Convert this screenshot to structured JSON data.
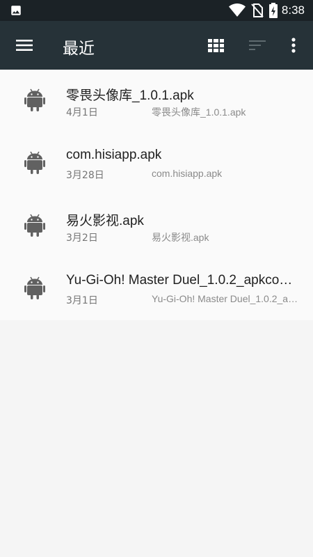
{
  "status_bar": {
    "time": "8:38",
    "icons": [
      "image-icon",
      "wifi-icon",
      "no-sim-icon",
      "battery-charging-icon"
    ]
  },
  "app_bar": {
    "title": "最近",
    "menu_icon": "hamburger-menu-icon",
    "actions": [
      "grid-view-icon",
      "sort-icon",
      "more-vert-icon"
    ]
  },
  "files": [
    {
      "name": "零畏头像库_1.0.1.apk",
      "date": "4月1日",
      "path": "零畏头像库_1.0.1.apk",
      "icon": "android-icon"
    },
    {
      "name": "com.hisiapp.apk",
      "date": "3月28日",
      "path": "com.hisiapp.apk",
      "icon": "android-icon"
    },
    {
      "name": "易火影视.apk",
      "date": "3月2日",
      "path": "易火影视.apk",
      "icon": "android-icon"
    },
    {
      "name": "Yu-Gi-Oh! Master Duel_1.0.2_apkco…",
      "date": "3月1日",
      "path": "Yu-Gi-Oh! Master Duel_1.0.2_a…",
      "icon": "android-icon"
    }
  ],
  "colors": {
    "status_bar_bg": "#1b2226",
    "app_bar_bg": "#263238",
    "list_bg": "#fafafa",
    "page_bg": "#f5f5f5",
    "icon_gray": "#616161"
  }
}
